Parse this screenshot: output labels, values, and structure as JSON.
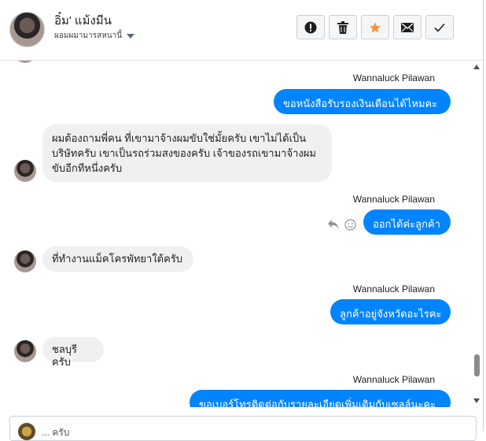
{
  "header": {
    "name": "อิ๋ม' แม้งมีน",
    "subtitle": "ผอมผมามารสหนานี้"
  },
  "messages": [
    {
      "dir": "out",
      "sender": "Wannaluck Pilawan",
      "text": "ขอหนังสือรับรองเงินเดือนได้ไหมคะ"
    },
    {
      "dir": "in",
      "lines": [
        "ผมต้องถามพี่คน ที่เขามาจ้างผมขับใช่มั้ยครับ เขาไม่ได้เป็น",
        "บริษัทครับ เขาเป็นรถร่วมสงของครับ เจ้าของรถเขามาจ้างผม",
        "ขับอีกทีหนึ่งครับ"
      ]
    },
    {
      "dir": "out",
      "sender": "Wannaluck Pilawan",
      "text": "ออกได้ค่ะลูกค้า"
    },
    {
      "dir": "in",
      "lines": [
        "ที่ทำงานแม็คโครพัทยาใต้ครับ"
      ]
    },
    {
      "dir": "out",
      "sender": "Wannaluck Pilawan",
      "text": "ลูกค้าอยู่จังหวัดอะไรคะ"
    },
    {
      "dir": "in",
      "lines": [
        "ชลบุรีครับ"
      ]
    },
    {
      "dir": "out",
      "sender": "Wannaluck Pilawan",
      "text": "ขอเบอร์โทรติดต่อกับรายละเอียดเพิ่มเติมกับเซลล์นะคะ"
    }
  ],
  "composer": {
    "text": "... ครับ"
  }
}
